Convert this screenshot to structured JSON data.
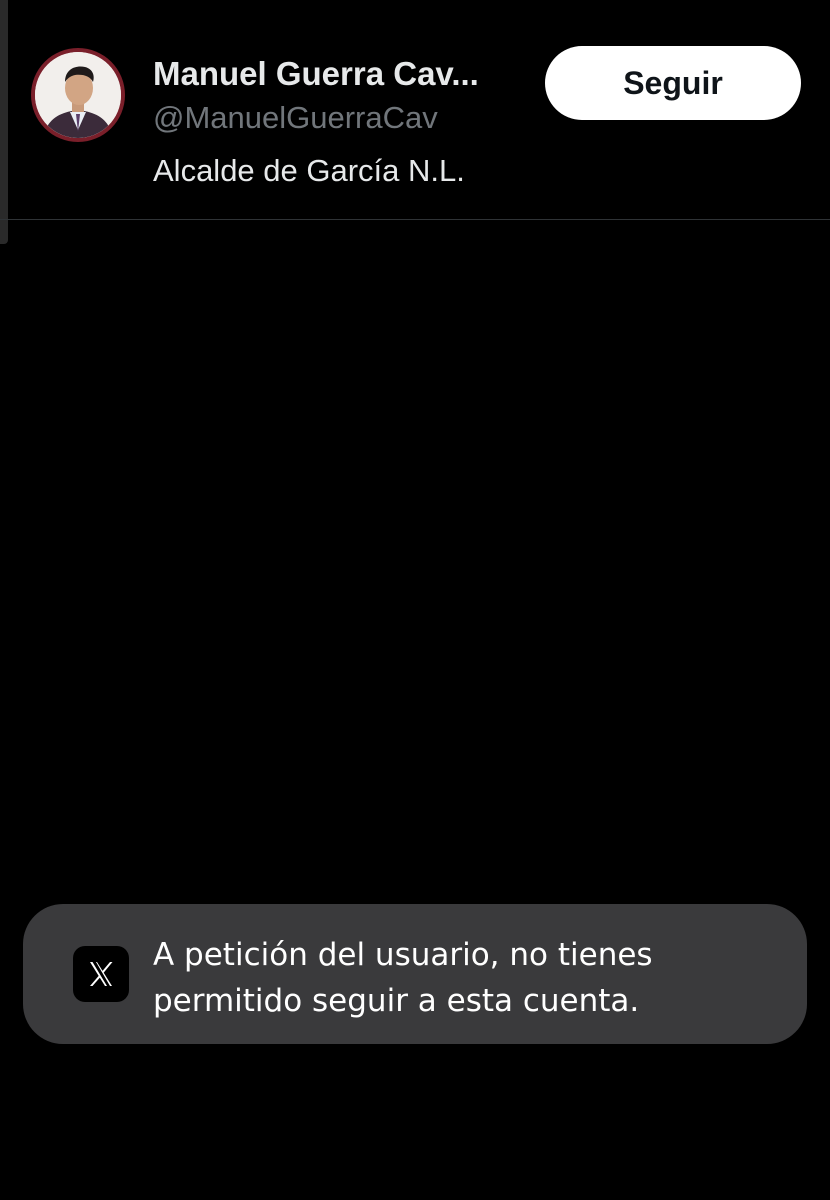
{
  "user": {
    "display_name": "Manuel Guerra Cav...",
    "handle": "@ManuelGuerraCav",
    "bio": "Alcalde de García N.L."
  },
  "follow_button": {
    "label": "Seguir"
  },
  "toast": {
    "icon": "x-logo-icon",
    "message": "A petición del usuario, no tienes permitido seguir a esta cuenta."
  },
  "colors": {
    "background": "#000000",
    "text_primary": "#e7e9ea",
    "text_secondary": "#71767b",
    "button_bg": "#ffffff",
    "toast_bg": "#3a3a3c",
    "divider": "#2f3336"
  }
}
